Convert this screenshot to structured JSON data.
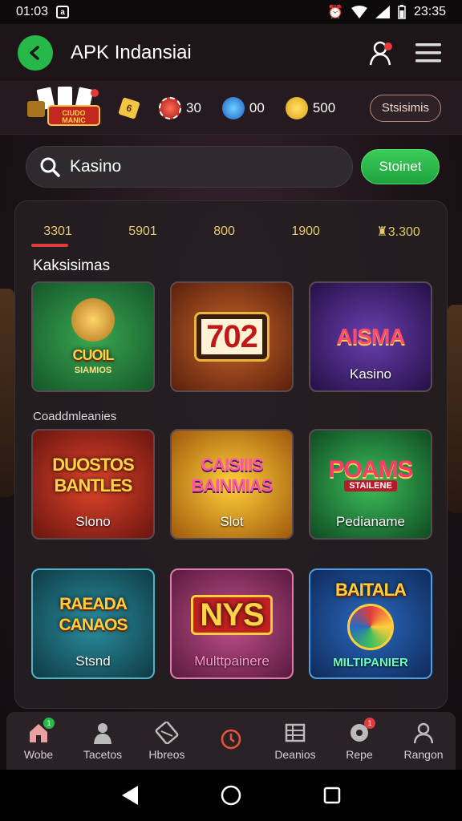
{
  "status_bar": {
    "time": "01:03",
    "right_time": "23:35"
  },
  "app_bar": {
    "title": "APK Indansiai"
  },
  "stats": {
    "logo_text": "CIUDO MANIC",
    "items": [
      {
        "icon": "chip-icon",
        "value": "30"
      },
      {
        "icon": "gem-icon",
        "value": "00"
      },
      {
        "icon": "emoji-coin-icon",
        "value": "500"
      }
    ],
    "button": "Stsisimis"
  },
  "search": {
    "value": "Kasino",
    "button": "Stoinet"
  },
  "tabs": [
    "3301",
    "5901",
    "800",
    "1900",
    "3.300"
  ],
  "sections": {
    "first": "Kaksisimas",
    "second": "Coaddmleanies"
  },
  "cards": [
    {
      "title": "CUOIL",
      "sub": "SIAMIOS",
      "label": "",
      "bg": "#1f7a34"
    },
    {
      "title": "702",
      "sub": "",
      "label": "",
      "bg": "#8a3a1c"
    },
    {
      "title": "AISMA",
      "sub": "",
      "label": "Kasino",
      "bg": "#3b1f6a"
    },
    {
      "title": "DUOSTOS BANTLES",
      "sub": "",
      "label": "Slono",
      "bg": "#8c1f1f"
    },
    {
      "title": "CAISIIIS BAINMIAS",
      "sub": "",
      "label": "Slot",
      "bg": "#b07a12"
    },
    {
      "title": "POAMS",
      "sub": "STAILENE",
      "label": "Pedianame",
      "bg": "#1d6b3a"
    },
    {
      "title": "RAEADA CANAOS",
      "sub": "",
      "label": "Stsnd",
      "bg": "#1b5f6e"
    },
    {
      "title": "NYS",
      "sub": "",
      "label": "Multtpainere",
      "bg": "#7a2a55"
    },
    {
      "title": "BAITALA",
      "sub": "",
      "label": "MILTIPANIER",
      "bg": "#17467a"
    }
  ],
  "bottom_nav": [
    {
      "label": "Wobe",
      "icon": "home-icon",
      "badge": "1"
    },
    {
      "label": "Tacetos",
      "icon": "person-icon"
    },
    {
      "label": "Hbreos",
      "icon": "cards-icon"
    },
    {
      "label": "",
      "icon": "clock-icon"
    },
    {
      "label": "Deanios",
      "icon": "grid-icon"
    },
    {
      "label": "Repe",
      "icon": "chat-icon",
      "badge": "1"
    },
    {
      "label": "Rangon",
      "icon": "profile-icon"
    }
  ]
}
